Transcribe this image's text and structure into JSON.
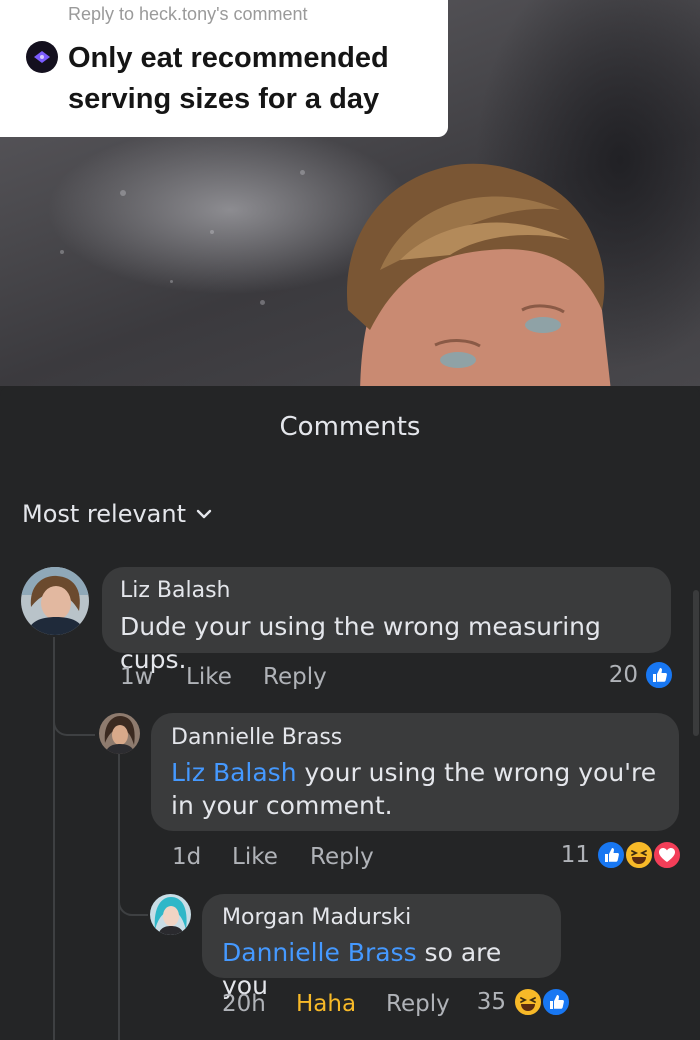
{
  "video": {
    "reply_to": "Reply to heck.tony's comment",
    "caption": "Only eat recommended serving sizes for a day"
  },
  "panel": {
    "title": "Comments",
    "sort_label": "Most relevant"
  },
  "comments": [
    {
      "author": "Liz Balash",
      "mention": "",
      "text": "Dude your using the wrong measuring cups.",
      "time": "1w",
      "like_label": "Like",
      "reply_label": "Reply",
      "reaction_count": "20",
      "reactions": [
        "like"
      ]
    },
    {
      "author": "Dannielle Brass",
      "mention": "Liz Balash",
      "text": " your using the wrong you're in your comment.",
      "time": "1d",
      "like_label": "Like",
      "reply_label": "Reply",
      "reaction_count": "11",
      "reactions": [
        "like",
        "haha",
        "love"
      ]
    },
    {
      "author": "Morgan Madurski",
      "mention": "Dannielle Brass",
      "text": " so are you",
      "time": "20h",
      "like_label": "Haha",
      "reply_label": "Reply",
      "reaction_count": "35",
      "reactions": [
        "haha",
        "like"
      ]
    }
  ],
  "colors": {
    "panel_bg": "#242526",
    "bubble_bg": "#3a3b3c",
    "mention": "#4599ff",
    "haha_selected": "#f7b928",
    "like_blue": "#1877f2",
    "love_red": "#f33e58"
  }
}
